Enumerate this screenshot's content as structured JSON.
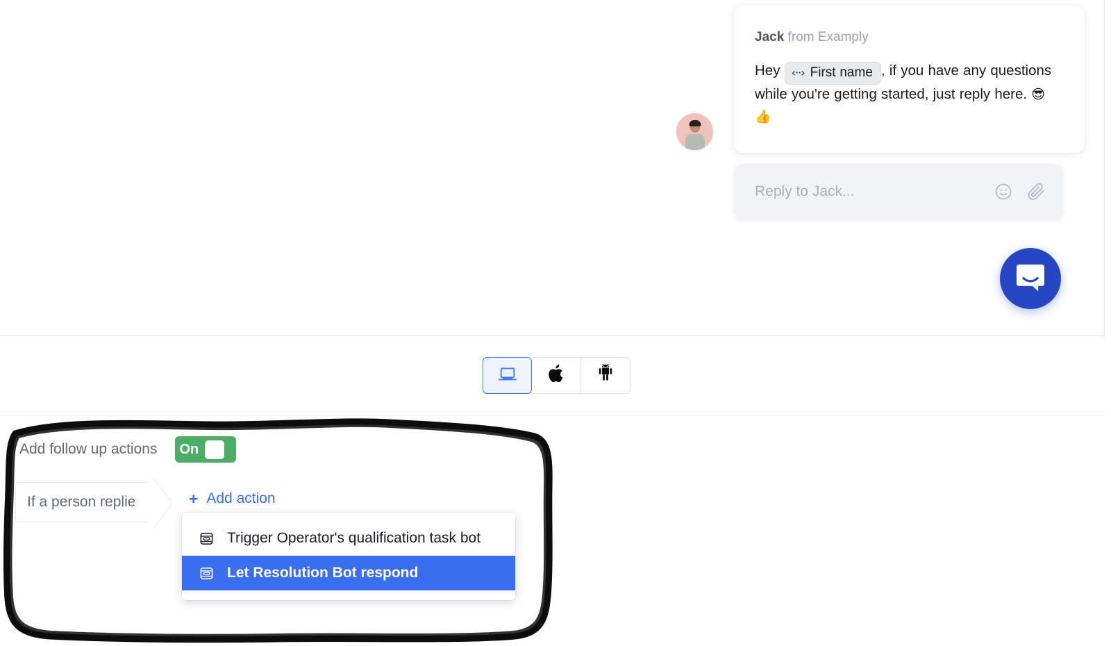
{
  "messenger": {
    "sender_name": "Jack",
    "sender_suffix": "from Examply",
    "message_prefix": "Hey",
    "attribute_pill": {
      "icon": "code-brackets-icon",
      "label": "First name"
    },
    "message_rest": ", if you have any questions while you're getting started, just reply here.",
    "emoji_1": "😎",
    "emoji_2": "👍",
    "composer_placeholder": "Reply to Jack...",
    "composer_icons": [
      "emoji-smiley-icon",
      "attachment-paperclip-icon"
    ],
    "launcher_icon": "intercom-messenger-icon",
    "avatar_alt": "avatar"
  },
  "device_toggle": {
    "options": [
      {
        "name": "desktop",
        "icon": "laptop-icon",
        "selected": true
      },
      {
        "name": "ios",
        "icon": "apple-logo-icon",
        "glyph": "",
        "selected": false
      },
      {
        "name": "android",
        "icon": "android-robot-icon",
        "selected": false
      }
    ]
  },
  "follow_up": {
    "title": "Add follow up actions",
    "toggle": {
      "state_label": "On",
      "enabled": true
    },
    "condition_tag": "If a person replies",
    "add_action": {
      "plus": "+",
      "label": "Add action"
    },
    "dropdown": {
      "items": [
        {
          "label": "Trigger Operator's qualification task bot",
          "icon": "bot-icon",
          "selected": false
        },
        {
          "label": "Let Resolution Bot respond",
          "icon": "bot-icon",
          "selected": true
        }
      ]
    }
  },
  "colors": {
    "brand_blue": "#2547c4",
    "accent_blue": "#3a6df0",
    "toggle_green": "#4cae64",
    "annotation_black": "#0d0d0d",
    "device_active_bg": "#eef3fe",
    "device_active_border": "#3d7df6"
  }
}
